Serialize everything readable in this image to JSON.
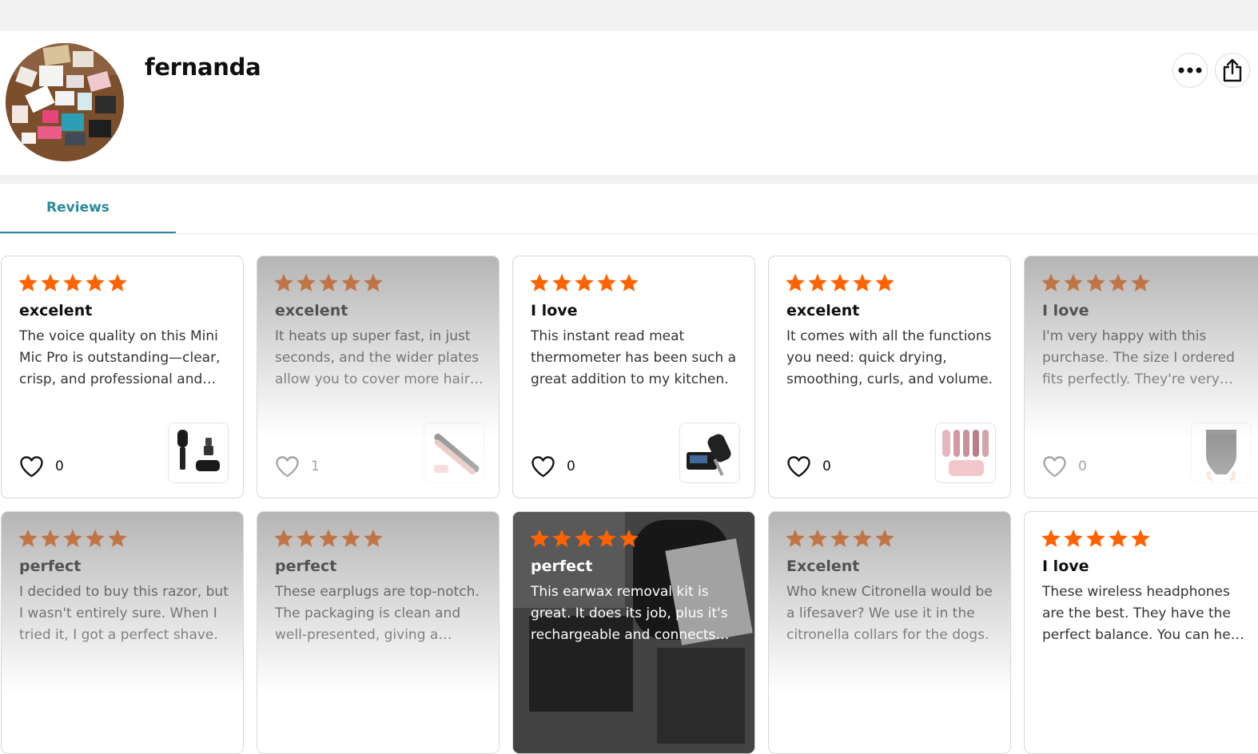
{
  "profile": {
    "username": "fernanda",
    "more_icon": "more-dots-icon",
    "share_icon": "share-icon"
  },
  "tabs": [
    {
      "label": "Reviews",
      "active": true
    }
  ],
  "colors": {
    "star": "#ff6200",
    "tab_accent": "#2b8a9a",
    "page_gray": "#f2f2f2"
  },
  "reviews": [
    {
      "rating": 5,
      "title": "excelent",
      "text": "The voice quality on this Mini Mic Pro is outstanding—clear, crisp, and professional and easy to use.",
      "likes": "0",
      "thumb": "wireless-mic-thumb"
    },
    {
      "rating": 5,
      "title": "excelent",
      "text": "It heats up super fast, in just seconds, and the wider plates allow you to cover more hair at once.",
      "likes": "1",
      "thumb": "flat-iron-thumb"
    },
    {
      "rating": 5,
      "title": "I love",
      "text": "This instant read meat thermometer has been such a great addition to my kitchen.",
      "likes": "0",
      "thumb": "meat-thermometer-thumb"
    },
    {
      "rating": 5,
      "title": "excelent",
      "text": "It comes with all the functions you need: quick drying, smoothing, curls, and volume.",
      "likes": "0",
      "thumb": "hair-styler-thumb"
    },
    {
      "rating": 5,
      "title": "I love",
      "text": "I'm very happy with this purchase. The size I ordered fits perfectly. They're very comfortable.",
      "likes": "0",
      "thumb": "shapewear-thumb"
    },
    {
      "rating": 5,
      "title": "perfect",
      "text": "I decided to buy this razor, but I wasn't entirely sure. When I tried it, I got a perfect shave.",
      "likes": "",
      "thumb": ""
    },
    {
      "rating": 5,
      "title": "perfect",
      "text": "These earplugs are top-notch. The packaging is clean and well-presented, giving a premium feel.",
      "likes": "",
      "thumb": ""
    },
    {
      "rating": 5,
      "title": "perfect",
      "text": "This earwax removal kit is great. It does its job, plus it's rechargeable and connects easily.",
      "likes": "",
      "thumb": ""
    },
    {
      "rating": 5,
      "title": "Excelent",
      "text": "Who knew Citronella would be a lifesaver? We use it in the citronella collars for the dogs.",
      "likes": "",
      "thumb": ""
    },
    {
      "rating": 5,
      "title": "I love",
      "text": "These wireless headphones are the best. They have the perfect balance. You can hear everything.",
      "likes": "",
      "thumb": ""
    }
  ]
}
